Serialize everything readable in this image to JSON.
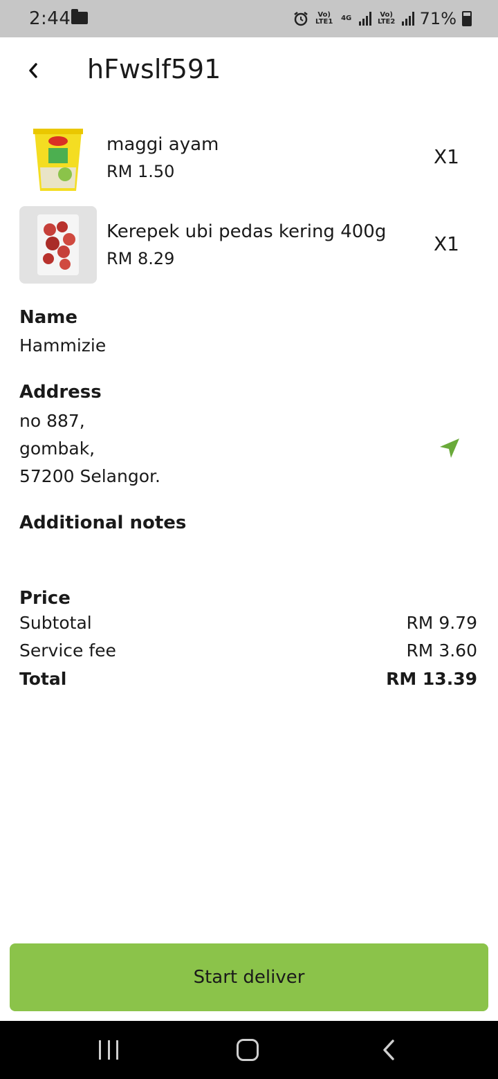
{
  "status_bar": {
    "time": "2:44",
    "lte1": "Vo) LTE1",
    "net": "4G",
    "lte2": "Vo) LTE2",
    "battery": "71%"
  },
  "header": {
    "title": "hFwslf591"
  },
  "items": [
    {
      "name": "maggi ayam",
      "price": "RM 1.50",
      "qty": "X1",
      "icon": "maggi-cup-image"
    },
    {
      "name": "Kerepek ubi pedas kering 400g",
      "price": "RM 8.29",
      "qty": "X1",
      "icon": "chips-bag-image"
    }
  ],
  "customer": {
    "name_label": "Name",
    "name": "Hammizie",
    "address_label": "Address",
    "address_lines": [
      "no 887,",
      "gombak,",
      "57200 Selangor."
    ],
    "notes_label": "Additional notes",
    "notes": ""
  },
  "price": {
    "label": "Price",
    "subtotal_label": "Subtotal",
    "subtotal": "RM 9.79",
    "service_label": "Service fee",
    "service": "RM 3.60",
    "total_label": "Total",
    "total": "RM 13.39"
  },
  "actions": {
    "deliver_label": "Start deliver"
  },
  "colors": {
    "accent": "#8bc34a",
    "nav_icon": "#6aaa3a",
    "status_bar_bg": "#c6c6c6"
  }
}
